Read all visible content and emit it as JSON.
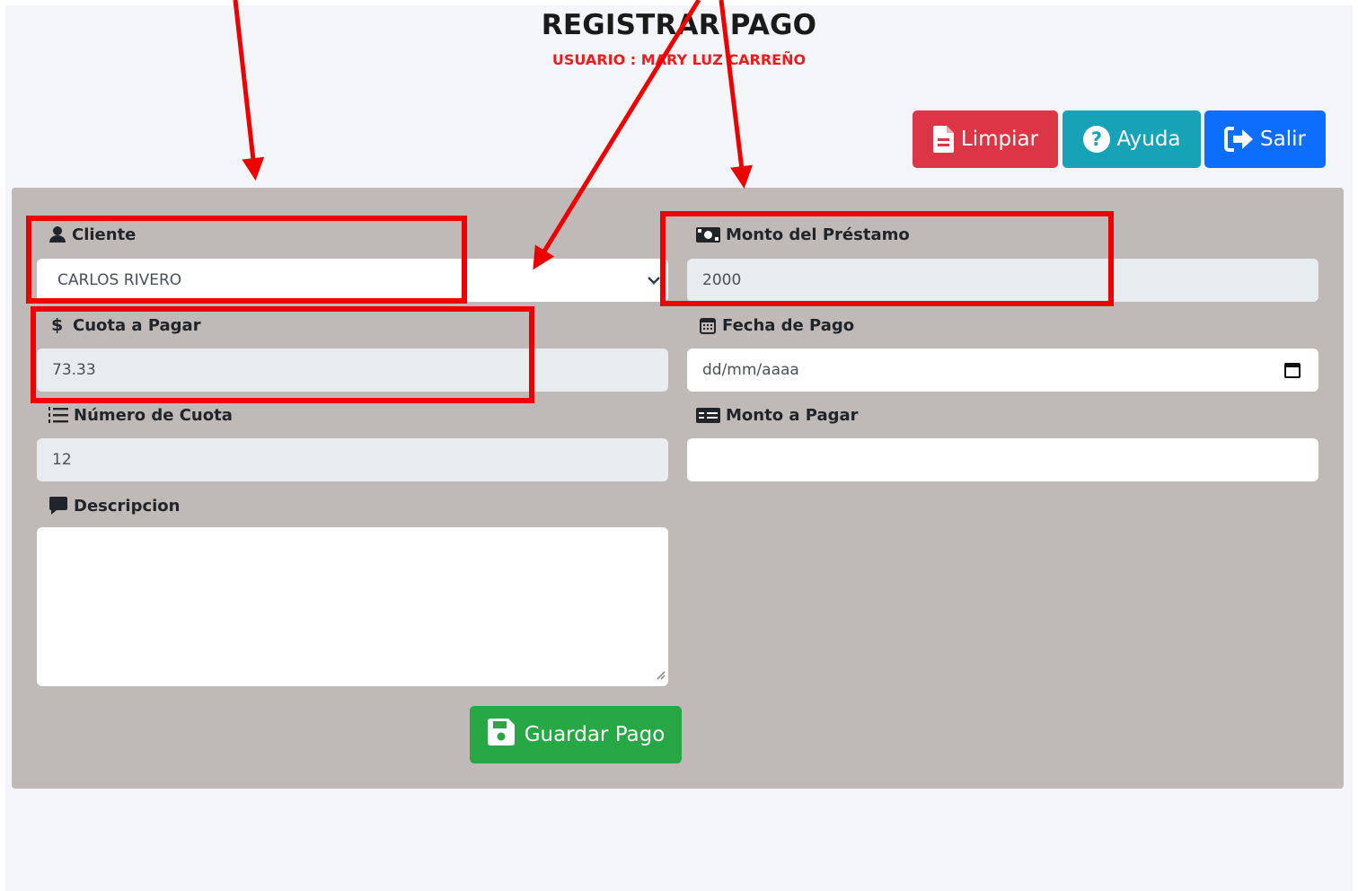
{
  "header": {
    "title": "REGISTRAR PAGO",
    "user_line": "USUARIO : MARY LUZ CARREÑO"
  },
  "toolbar": {
    "limpiar_label": "Limpiar",
    "ayuda_label": "Ayuda",
    "salir_label": "Salir"
  },
  "form": {
    "cliente": {
      "label": "Cliente",
      "value": "CARLOS RIVERO"
    },
    "monto_prestamo": {
      "label": "Monto del Préstamo",
      "value": "2000"
    },
    "cuota_pagar": {
      "label": "Cuota a Pagar",
      "value": "73.33"
    },
    "fecha_pago": {
      "label": "Fecha de Pago",
      "placeholder": "dd/mm/aaaa"
    },
    "numero_cuota": {
      "label": "Número de Cuota",
      "value": "12"
    },
    "monto_pagar": {
      "label": "Monto a Pagar",
      "value": ""
    },
    "descripcion": {
      "label": "Descripcion",
      "value": ""
    },
    "save_label": "Guardar Pago"
  },
  "colors": {
    "limpiar": "#dc3545",
    "ayuda": "#17a2b8",
    "salir": "#0d6efd",
    "guardar": "#28a745",
    "panel": "#bfb9b8",
    "annotation": "#ee0000"
  }
}
